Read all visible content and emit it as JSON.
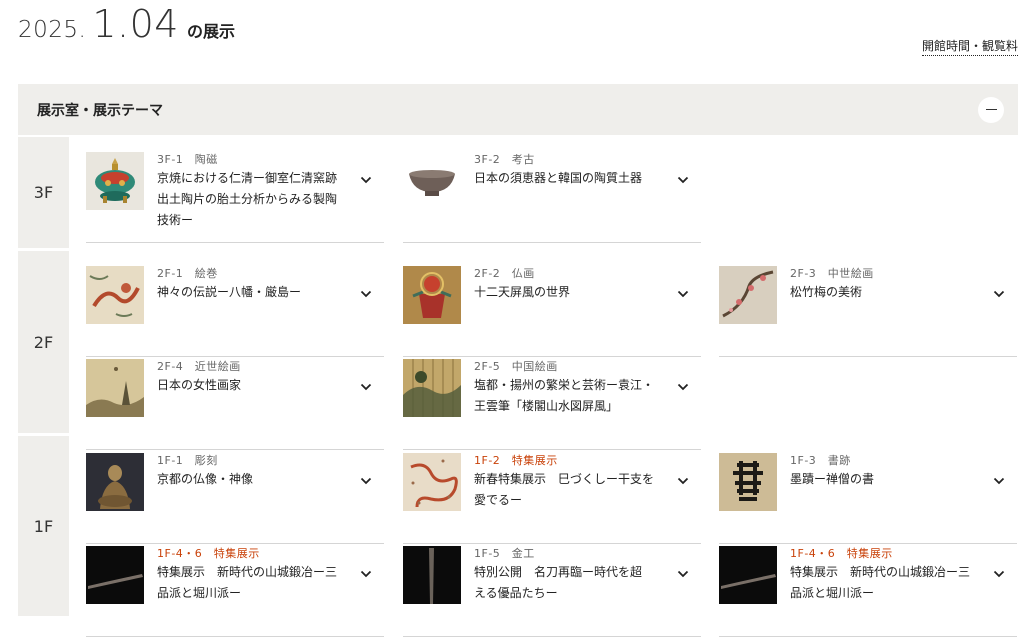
{
  "header": {
    "year": "2025.",
    "month_day": "1.04",
    "suffix": "の展示",
    "hours_link": "開館時間・観覧料"
  },
  "panel": {
    "title": "展示室・展示テーマ"
  },
  "colors": {
    "panel_bg": "#efeeeb",
    "accent": "#c9420a",
    "divider": "#d5d5d5"
  },
  "floors": [
    {
      "label": "3F",
      "rooms": [
        {
          "room": "3F-1",
          "category": "陶磁",
          "featured": false,
          "title": "京焼における仁清ー御室仁清窯跡出土陶片の胎土分析からみる製陶技術ー",
          "thumb_icon": "incense-burner-icon"
        },
        {
          "room": "3F-2",
          "category": "考古",
          "featured": false,
          "title": "日本の須恵器と韓国の陶質土器",
          "thumb_icon": "bowl-icon"
        }
      ]
    },
    {
      "label": "2F",
      "rooms": [
        {
          "room": "2F-1",
          "category": "絵巻",
          "featured": false,
          "title": "神々の伝説ー八幡・厳島ー",
          "thumb_icon": "dragon-scroll-icon"
        },
        {
          "room": "2F-2",
          "category": "仏画",
          "featured": false,
          "title": "十二天屏風の世界",
          "thumb_icon": "deity-painting-icon"
        },
        {
          "room": "2F-3",
          "category": "中世絵画",
          "featured": false,
          "title": "松竹梅の美術",
          "thumb_icon": "plum-branch-icon"
        },
        {
          "room": "2F-4",
          "category": "近世絵画",
          "featured": false,
          "title": "日本の女性画家",
          "thumb_icon": "landscape-painting-icon"
        },
        {
          "room": "2F-5",
          "category": "中国絵画",
          "featured": false,
          "title": "塩都・揚州の繁栄と芸術ー袁江・王雲筆「楼閣山水図屏風」",
          "thumb_icon": "folding-screen-icon"
        }
      ]
    },
    {
      "label": "1F",
      "rooms": [
        {
          "room": "1F-1",
          "category": "彫刻",
          "featured": false,
          "title": "京都の仏像・神像",
          "thumb_icon": "buddha-statue-icon"
        },
        {
          "room": "1F-2",
          "category": "特集展示",
          "featured": true,
          "title": "新春特集展示　巳づくしー干支を愛でるー",
          "thumb_icon": "snake-painting-icon"
        },
        {
          "room": "1F-3",
          "category": "書跡",
          "featured": false,
          "title": "墨蹟ー禅僧の書",
          "thumb_icon": "calligraphy-icon"
        },
        {
          "room": "1F-4・6",
          "category": "特集展示",
          "featured": true,
          "title": "特集展示　新時代の山城鍛冶ー三品派と堀川派ー",
          "thumb_icon": "sword-blade-icon"
        },
        {
          "room": "1F-5",
          "category": "金工",
          "featured": false,
          "title": "特別公開　名刀再臨ー時代を超える優品たちー",
          "thumb_icon": "sword-vertical-icon"
        },
        {
          "room": "1F-4・6",
          "category": "特集展示",
          "featured": true,
          "title": "特集展示　新時代の山城鍛冶ー三品派と堀川派ー",
          "thumb_icon": "sword-blade-icon"
        }
      ]
    }
  ]
}
